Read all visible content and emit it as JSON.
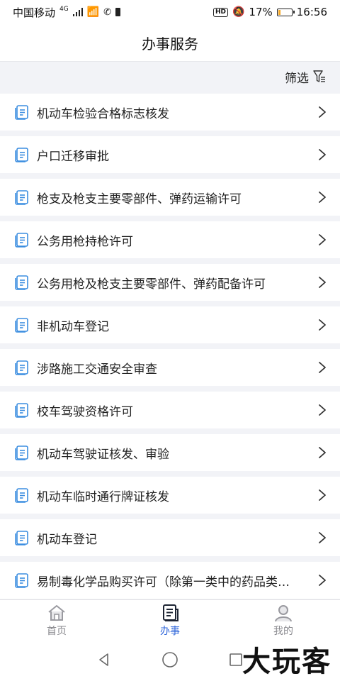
{
  "status_bar": {
    "carrier": "中国移动",
    "network": "4G",
    "battery": "17%",
    "battery_level": 0.17,
    "time": "16:56",
    "hd_badge": "HD"
  },
  "header": {
    "title": "办事服务"
  },
  "filter": {
    "label": "筛选"
  },
  "items": [
    {
      "label": "机动车检验合格标志核发"
    },
    {
      "label": "户口迁移审批"
    },
    {
      "label": "枪支及枪支主要零部件、弹药运输许可"
    },
    {
      "label": "公务用枪持枪许可"
    },
    {
      "label": "公务用枪及枪支主要零部件、弹药配备许可"
    },
    {
      "label": "非机动车登记"
    },
    {
      "label": "涉路施工交通安全审查"
    },
    {
      "label": "校车驾驶资格许可"
    },
    {
      "label": "机动车驾驶证核发、审验"
    },
    {
      "label": "机动车临时通行牌证核发"
    },
    {
      "label": "机动车登记"
    },
    {
      "label": "易制毒化学品购买许可（除第一类中的药品类…"
    }
  ],
  "tabs": [
    {
      "label": "首页",
      "icon": "home-icon",
      "active": false
    },
    {
      "label": "办事",
      "icon": "document-icon",
      "active": true
    },
    {
      "label": "我的",
      "icon": "user-icon",
      "active": false
    }
  ],
  "colors": {
    "accent": "#2d64d9",
    "icon_blue": "#3b8de0"
  },
  "watermark": "大玩客"
}
